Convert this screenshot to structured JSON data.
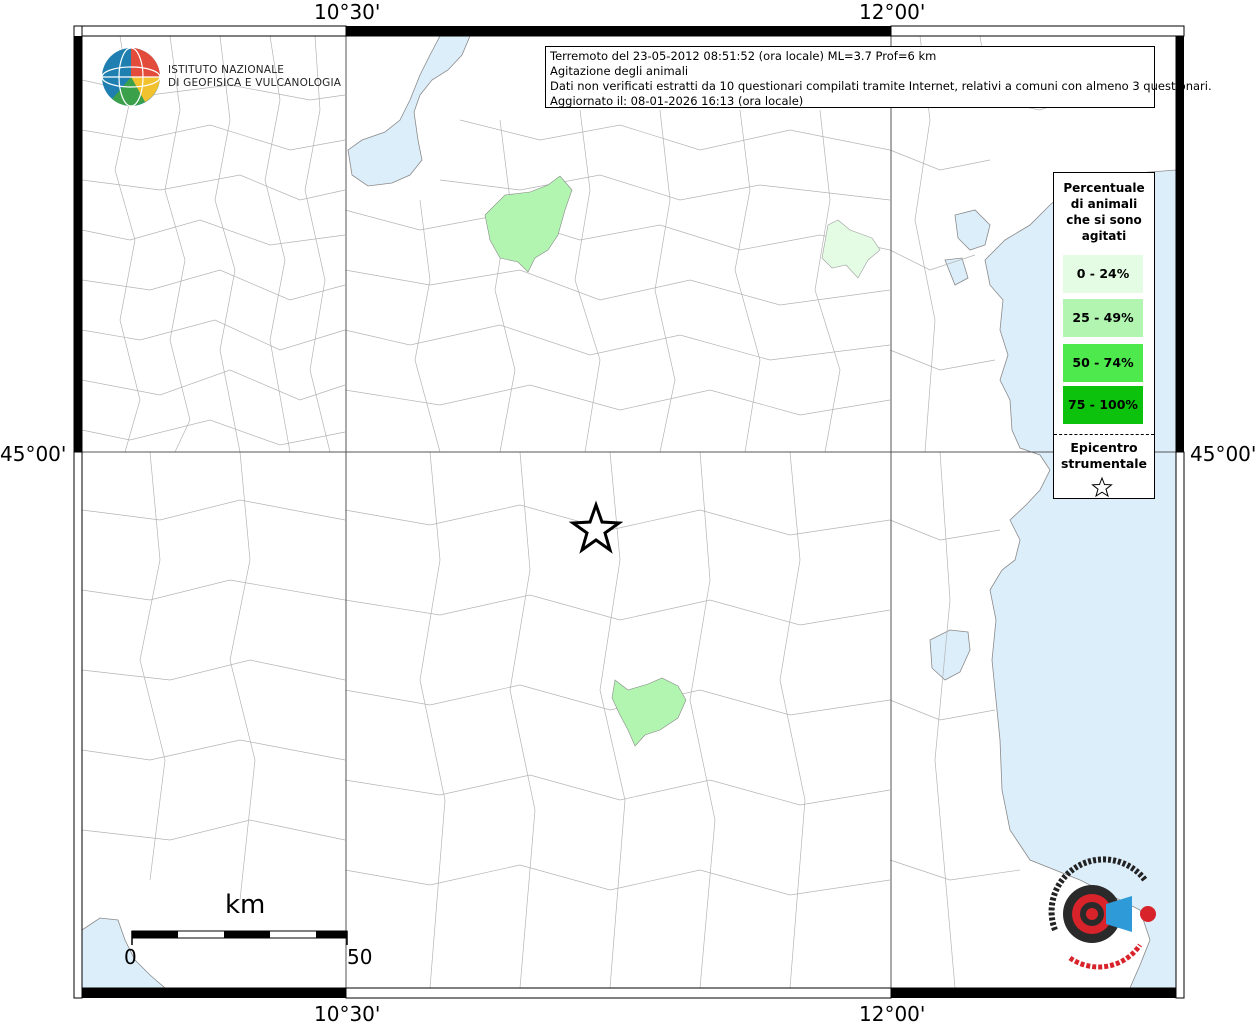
{
  "map": {
    "coord_labels": {
      "lon_left": "10°30'",
      "lon_right": "12°00'",
      "lat_mid": "45°00'"
    },
    "info_box": {
      "line1": "Terremoto del 23-05-2012 08:51:52 (ora locale) ML=3.7 Prof=6 km",
      "line2": "Agitazione degli animali",
      "line3": "Dati non verificati estratti da 10 questionari compilati tramite Internet, relativi a comuni con almeno 3 questionari.",
      "line4": "Aggiornato il: 08-01-2026 16:13 (ora locale)"
    },
    "logo": {
      "line1": "ISTITUTO NAZIONALE",
      "line2": "DI GEOFISICA E VULCANOLOGIA"
    },
    "legend": {
      "title": "Percentuale di animali che si sono agitati",
      "classes": [
        {
          "label": "0 - 24%",
          "color": "#e3fce3"
        },
        {
          "label": "25 - 49%",
          "color": "#b1f5b1"
        },
        {
          "label": "50 - 74%",
          "color": "#4de94d"
        },
        {
          "label": "75 - 100%",
          "color": "#0cc20c"
        }
      ],
      "epicenter_label": "Epicentro strumentale"
    },
    "scale": {
      "unit": "km",
      "start": "0",
      "end": "50"
    },
    "colors": {
      "water": "#dceefa",
      "boundary": "#b4b4b4",
      "frame": "#000000"
    }
  }
}
